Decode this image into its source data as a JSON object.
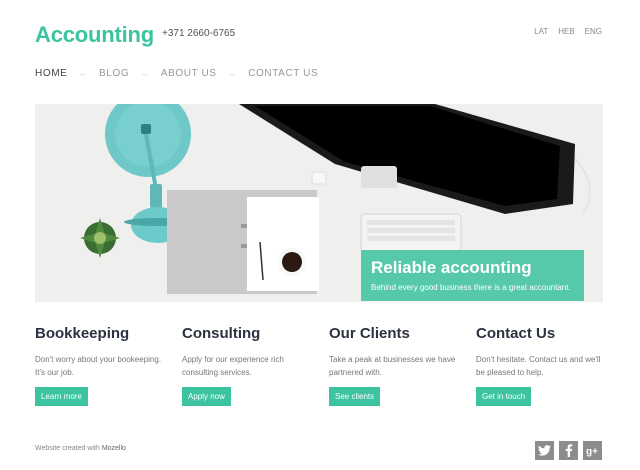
{
  "header": {
    "logo": "Accounting",
    "phone": "+371 2660-6765",
    "languages": [
      "LAT",
      "HEB",
      "ENG"
    ]
  },
  "nav": {
    "items": [
      "HOME",
      "BLOG",
      "ABOUT US",
      "CONTACT US"
    ],
    "active": "HOME"
  },
  "hero": {
    "title": "Reliable accounting",
    "subtitle": "Behind every good business there is a great accountant."
  },
  "columns": [
    {
      "title": "Bookkeeping",
      "text": "Don't worry about your bookeeping. It's our job.",
      "button": "Learn more"
    },
    {
      "title": "Consulting",
      "text": "Apply for our experience rich consulting services.",
      "button": "Apply now"
    },
    {
      "title": "Our Clients",
      "text": "Take a peak at businesses we have partnered with.",
      "button": "See clients"
    },
    {
      "title": "Contact Us",
      "text": "Don't hesitate. Contact us and we'll be pleased to help.",
      "button": "Get in touch"
    }
  ],
  "footer": {
    "text": "Website created with",
    "brand": "Mozello",
    "social": [
      "twitter-icon",
      "facebook-icon",
      "google-plus-icon"
    ]
  },
  "colors": {
    "accent": "#3cc3a0",
    "heading": "#2b3240",
    "social": "#8c8c8c"
  }
}
